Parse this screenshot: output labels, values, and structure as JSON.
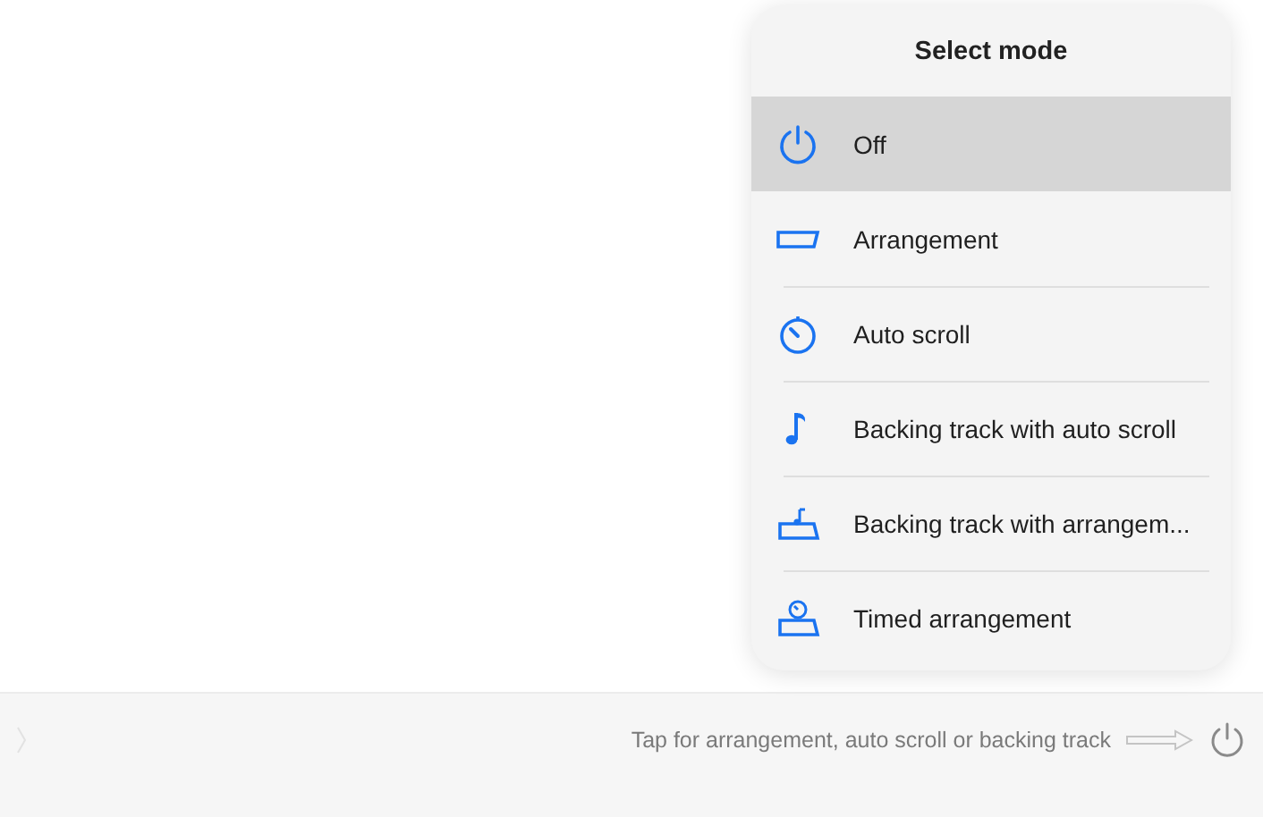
{
  "popover": {
    "title": "Select mode",
    "items": [
      {
        "kind": "power",
        "label": "Off",
        "selected": true
      },
      {
        "kind": "arrangement",
        "label": "Arrangement",
        "selected": false
      },
      {
        "kind": "autoscroll",
        "label": "Auto scroll",
        "selected": false
      },
      {
        "kind": "note",
        "label": "Backing track with auto scroll",
        "selected": false
      },
      {
        "kind": "note-arrangement",
        "label": "Backing track with arrangem...",
        "selected": false
      },
      {
        "kind": "timed",
        "label": "Timed arrangement",
        "selected": false
      }
    ]
  },
  "bottom_bar": {
    "hint": "Tap for arrangement, auto scroll or backing track"
  }
}
